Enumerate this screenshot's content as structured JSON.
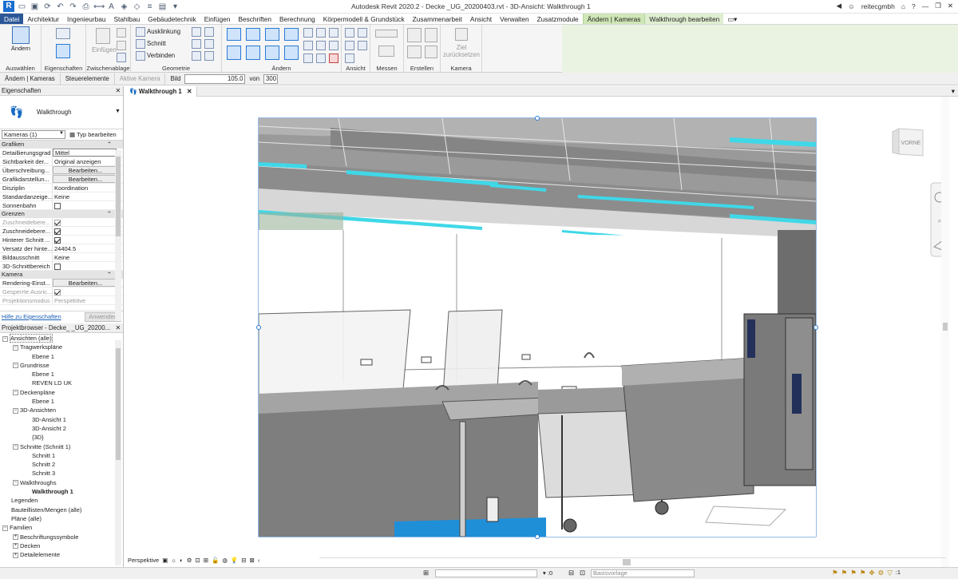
{
  "title": {
    "text": "Autodesk Revit 2020.2 - Decke     _UG_20200403.rvt - 3D-Ansicht: Walkthrough 1",
    "user": "reitecgmbh",
    "help": "?"
  },
  "tabs": [
    "Datei",
    "Architektur",
    "Ingenieurbau",
    "Stahlbau",
    "Gebäudetechnik",
    "Einfügen",
    "Beschriften",
    "Berechnung",
    "Körpermodell & Grundstück",
    "Zusammenarbeit",
    "Ansicht",
    "Verwalten",
    "Zusatzmodule",
    "Ändern | Kameras",
    "Walkthrough bearbeiten"
  ],
  "ribbon": {
    "modify_label": "Ändern",
    "paste_label": "Einfügen",
    "cut_label": "Ausklinkung",
    "cut2_label": "Schnitt",
    "join_label": "Verbinden",
    "reset_label": "Ziel zurücksetzen",
    "panels": {
      "select": "Auswählen",
      "props": "Eigenschaften",
      "clipboard": "Zwischenablage",
      "geometry": "Geometrie",
      "modify": "Ändern",
      "view": "Ansicht",
      "measure": "Messen",
      "create": "Erstellen",
      "camera": "Kamera"
    }
  },
  "options": {
    "context": "Ändern | Kameras",
    "controls": "Steuerelemente",
    "active_camera": "Aktive Kamera",
    "frame_label": "Bild",
    "frame_value": "105.0",
    "of_label": "von",
    "total": "300"
  },
  "properties": {
    "header": "Eigenschaften",
    "type_name": "Walkthrough",
    "selector": "Kameras (1)",
    "edit_type": "Typ bearbeiten",
    "groups": [
      {
        "name": "Grafiken",
        "rows": [
          {
            "k": "Detaillierungsgrad",
            "v": "Mittel",
            "style": "box"
          },
          {
            "k": "Sichtbarkeit der...",
            "v": "Original anzeigen"
          },
          {
            "k": "Überschreibung...",
            "v": "Bearbeiten...",
            "style": "btn"
          },
          {
            "k": "Grafikdarstellun...",
            "v": "Bearbeiten...",
            "style": "btn"
          },
          {
            "k": "Disziplin",
            "v": "Koordination"
          },
          {
            "k": "Standardanzeige...",
            "v": "Keine"
          },
          {
            "k": "Sonnenbahn",
            "v": "",
            "check": "off"
          }
        ]
      },
      {
        "name": "Grenzen",
        "rows": [
          {
            "k": "Zuschneidebere...",
            "v": "",
            "check": "dis",
            "dis": true
          },
          {
            "k": "Zuschneidebere...",
            "v": "",
            "check": "on"
          },
          {
            "k": "Hinterer Schnitt ...",
            "v": "",
            "check": "on"
          },
          {
            "k": "Versatz der hinte...",
            "v": "24404.5"
          },
          {
            "k": "Bildausschnitt",
            "v": "Keine"
          },
          {
            "k": "3D-Schnittbereich",
            "v": "",
            "check": "off"
          }
        ]
      },
      {
        "name": "Kamera",
        "rows": [
          {
            "k": "Rendering-Einst...",
            "v": "Bearbeiten...",
            "style": "btn"
          },
          {
            "k": "Gesperrte Ausric...",
            "v": "",
            "check": "dis",
            "dis": true
          },
          {
            "k": "Projektionsmodus",
            "v": "Perspektive",
            "dis": true
          }
        ]
      }
    ],
    "help_link": "Hilfe zu Eigenschaften",
    "apply": "Anwenden"
  },
  "browser": {
    "header": "Projektbrowser - Decke_      _UG_20200...",
    "nodes": [
      {
        "t": "Ansichten (alle)",
        "l": 0,
        "e": "-",
        "sel": true
      },
      {
        "t": "Tragwerkspläne",
        "l": 1,
        "e": "-"
      },
      {
        "t": "Ebene 1",
        "l": 2
      },
      {
        "t": "Grundrisse",
        "l": 1,
        "e": "-"
      },
      {
        "t": "Ebene 1",
        "l": 2
      },
      {
        "t": "REVEN LD UK",
        "l": 2
      },
      {
        "t": "Deckenpläne",
        "l": 1,
        "e": "-"
      },
      {
        "t": "Ebene 1",
        "l": 2
      },
      {
        "t": "3D-Ansichten",
        "l": 1,
        "e": "-"
      },
      {
        "t": "3D-Ansicht 1",
        "l": 2
      },
      {
        "t": "3D-Ansicht 2",
        "l": 2
      },
      {
        "t": "{3D}",
        "l": 2
      },
      {
        "t": "Schnitte (Schnitt 1)",
        "l": 1,
        "e": "-"
      },
      {
        "t": "Schnitt 1",
        "l": 2
      },
      {
        "t": "Schnitt 2",
        "l": 2
      },
      {
        "t": "Schnitt 3",
        "l": 2
      },
      {
        "t": "Walkthroughs",
        "l": 1,
        "e": "-"
      },
      {
        "t": "Walkthrough 1",
        "l": 2,
        "bold": true
      },
      {
        "t": "Legenden",
        "l": 0
      },
      {
        "t": "Bauteillisten/Mengen (alle)",
        "l": 0
      },
      {
        "t": "Pläne (alle)",
        "l": 0
      },
      {
        "t": "Familien",
        "l": 0,
        "e": "-"
      },
      {
        "t": "Beschriftungssymbole",
        "l": 1,
        "e": "+"
      },
      {
        "t": "Decken",
        "l": 1,
        "e": "+"
      },
      {
        "t": "Detailelemente",
        "l": 1,
        "e": "+"
      }
    ]
  },
  "view": {
    "tab_label": "Walkthrough 1",
    "viewcube": "VORNE",
    "control_label": "Perspektive"
  },
  "status": {
    "selection_count": ":0",
    "model": "Basisvorlage",
    "filter_count": ":1"
  },
  "colors": {
    "file_tab": "#2b5797",
    "context_tab": "#dfeed0",
    "lights": "#3fd8e8",
    "selection": "#2a7ad6"
  }
}
